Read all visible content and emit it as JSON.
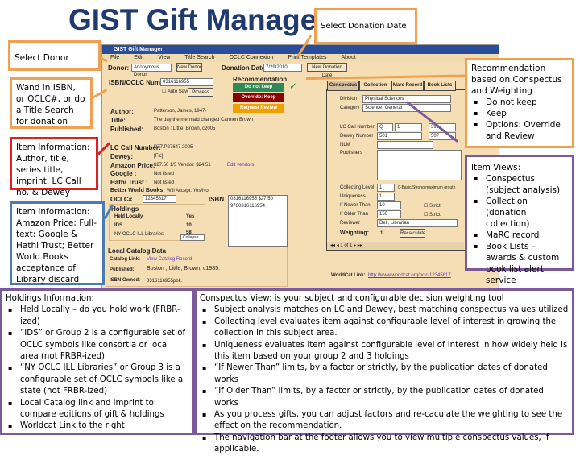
{
  "title": "GIST Gift Manager",
  "callouts": {
    "donation_date": "Select Donation Date",
    "donor": "Select Donor",
    "wand": "Wand in ISBN, or OCLC#, or do a Title Search for donation",
    "item_info1": "Item Information: Author, title, series title, imprint, LC Call no. & Dewey",
    "item_info2": "Item Information: Amazon Price; Full-text: Google & Hathi Trust; Better World Books acceptance of Library discard",
    "recommendation": {
      "heading": "Recommendation based on Conspectus and Weighting",
      "items": [
        "Do not keep",
        "Keep",
        "Options: Override and Review"
      ]
    },
    "item_views": {
      "heading": "Item Views:",
      "items": [
        "Conspectus (subject analysis)",
        "Collection (donation collection)",
        "MaRC record",
        "Book Lists – awards & custom book list alert service"
      ]
    }
  },
  "app": {
    "window_title": "GIST Gift Manager",
    "menu": [
      "File",
      "Edit",
      "View",
      "Title Search",
      "OCLC Connexion",
      "Print Templates",
      "About"
    ],
    "donor_label": "Donor:",
    "donor_value": "Anonymous Donor",
    "new_donor": "New Donor",
    "date_label": "Donation Date:",
    "date_value": "7/29/2010",
    "new_date": "New Donation Date",
    "isbn_label": "ISBN/OCLC Number",
    "isbn_value": "0316116955",
    "auto_save": "Auto Save",
    "process": "Process",
    "rec_label": "Recommendation",
    "rec_buttons": [
      "Do not keep",
      "Override: Keep",
      "Request Review"
    ],
    "author_label": "Author:",
    "author_value": "Patterson, James, 1947-",
    "title_label": "Title:",
    "title_value": "The day the mermaid changed Carmen Brown",
    "published_label": "Published:",
    "published_value": "Boston : Little, Brown, c2005",
    "lc_label": "LC Call Number:",
    "lc_value": "PZ7.P27647 2005",
    "dewey_label": "Dewey:",
    "dewey_value": "[Fic]",
    "amazon_label": "Amazon Price:",
    "amazon_value": "$27.50 1/5 Vendor: $24.51",
    "amazon_link": "Edit vendors",
    "google_label": "Google :",
    "google_value": "Not listed",
    "hathi_label": "Hathi Trust :",
    "hathi_value": "Not listed",
    "bwb_label": "Better World Books:",
    "bwb_value": "Will Accept: Yes/No",
    "oclc_label": "OCLC#",
    "oclc_value": "12345617",
    "isbn2_label": "ISBN",
    "isbn2_value": "0316116955 $27.50 9780316116954",
    "holdings": {
      "heading": "Holdings",
      "rows": [
        [
          "Held Locally",
          "Yes"
        ],
        [
          "IDS",
          "10"
        ],
        [
          "NY OCLC ILL Libraries",
          "58"
        ]
      ],
      "select": "Collapse"
    },
    "local": {
      "heading": "Local Catalog Data",
      "link_label": "Catalog Link:",
      "link_value": "View Catalog Record",
      "pub_label": "Published:",
      "pub_value": "Boston , Little, Brown, c1985.",
      "isbn_label": "ISBN Owned:",
      "isbn_value": "0316116955pbk."
    },
    "tabs": [
      "Conspectus",
      "Collection",
      "Marc Record",
      "Book Lists"
    ],
    "consp": {
      "division_label": "Division",
      "division_value": "Physical Sciences",
      "category_label": "Category",
      "category_value": "Science, General",
      "lc_label": "LC Call Number",
      "lc_a": "Q",
      "lc_b": "1",
      "lc_c": "390",
      "dewey_label": "Dewey Number",
      "dewey_a": "501",
      "dewey_b": "507",
      "nlm_label": "NLM",
      "pub_label": "Publishers",
      "cl_label": "Collecting Level",
      "cl_value": "1",
      "cl_note": "0-Basic/Strong maximum grouth",
      "uniq_label": "Uniqueness",
      "uniq_value": "1",
      "newer_label": "If Newer Than",
      "newer_value": "10",
      "older_label": "If Older Than",
      "older_value": "150",
      "strict": "Strict",
      "reviewer_label": "Reviewer",
      "reviewer_value": "Dell, Librarian",
      "weighting_label": "Weighting:",
      "weighting_value": "1",
      "recalc": "Recalculate",
      "nav_page": "1",
      "nav_of": "of 1"
    },
    "worldcat_label": "WorldCat Link:",
    "worldcat_value": "http://www.worldcat.org/oclc/12345617"
  },
  "bottom": {
    "left_heading": "Holdings Information:",
    "left_items": [
      "Held Locally – do you hold work (FRBR-ized)",
      "“IDS” or Group 2 is a configurable set of OCLC symbols like consortia or local area (not FRBR-ized)",
      "“NY OCLC ILL Libraries” or Group 3 is a configurable set of OCLC symbols like a state (not FRBR-ized)",
      "Local Catalog link and imprint to compare editions of gift & holdings",
      "Worldcat Link to the right"
    ],
    "right_heading": "Conspectus View: is your subject and configurable decision weighting tool",
    "right_items": [
      "Subject analysis matches on LC and Dewey, best matching conspectus values utilized",
      "Collecting level evaluates item against configurable level of interest in growing the collection in this subject area.",
      "Uniqueness evaluates item against configurable level of interest in how widely held is this item based on your group 2 and 3 holdings",
      "“If Newer Than” limits, by a factor or strictly, by the publication dates of donated works",
      "“If Older Than” limits, by a factor or strictly, by the publication dates of donated works",
      "As you process gifts, you can adjust factors and re-caculate the weighting to see the effect on the recommendation.",
      "The navigation bar at the footer allows you to view multiple conspectus values, if applicable."
    ]
  },
  "colors": {
    "title": "#1f3a6e",
    "orange": "#f0a050",
    "red": "#e02020",
    "blue": "#4a7cb0",
    "purple": "#7a5a9a",
    "app_bg": "#f5deb3",
    "do_not_keep": "#2e8b57",
    "override": "#8b0000",
    "review": "#f0a000"
  }
}
